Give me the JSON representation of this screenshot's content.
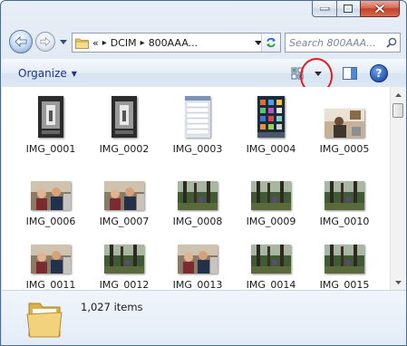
{
  "window": {
    "caption": {
      "minimize": "minimize",
      "maximize": "maximize",
      "close": "close"
    }
  },
  "nav": {
    "back_icon": "back-arrow-icon",
    "forward_icon": "forward-arrow-icon",
    "address": {
      "overflow": "«",
      "crumbs": [
        "DCIM",
        "800AAA..."
      ]
    },
    "search": {
      "placeholder": "Search 800AAA..."
    }
  },
  "toolbar": {
    "organize_label": "Organize",
    "icons": [
      "change-view-icon",
      "view-options-dropdown-icon",
      "preview-pane-icon",
      "help-icon"
    ],
    "help_label": "?"
  },
  "annotation": {
    "color": "#e41c1c",
    "target": "view-options-dropdown"
  },
  "files": [
    {
      "name": "IMG_0001",
      "kind": "portrait-dark"
    },
    {
      "name": "IMG_0002",
      "kind": "portrait-dark"
    },
    {
      "name": "IMG_0003",
      "kind": "portrait-phone-list"
    },
    {
      "name": "IMG_0004",
      "kind": "portrait-phone-home"
    },
    {
      "name": "IMG_0005",
      "kind": "landscape-room"
    },
    {
      "name": "IMG_0006",
      "kind": "landscape-people"
    },
    {
      "name": "IMG_0007",
      "kind": "landscape-people"
    },
    {
      "name": "IMG_0008",
      "kind": "landscape-forest"
    },
    {
      "name": "IMG_0009",
      "kind": "landscape-forest"
    },
    {
      "name": "IMG_0010",
      "kind": "landscape-forest"
    },
    {
      "name": "IMG_0011",
      "kind": "landscape-people"
    },
    {
      "name": "IMG_0012",
      "kind": "landscape-forest"
    },
    {
      "name": "IMG_0013",
      "kind": "landscape-people"
    },
    {
      "name": "IMG_0014",
      "kind": "landscape-forest"
    },
    {
      "name": "IMG_0015",
      "kind": "landscape-forest"
    }
  ],
  "details": {
    "count_label": "1,027 items"
  }
}
